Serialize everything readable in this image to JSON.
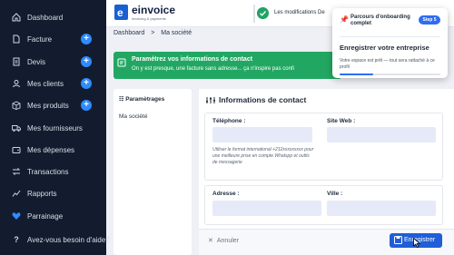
{
  "sidebar": {
    "items": [
      {
        "label": "Dashboard",
        "icon": "home-icon",
        "has_add": false
      },
      {
        "label": "Facture",
        "icon": "file-icon",
        "has_add": true
      },
      {
        "label": "Devis",
        "icon": "document-icon",
        "has_add": true
      },
      {
        "label": "Mes clients",
        "icon": "user-icon",
        "has_add": true
      },
      {
        "label": "Mes produits",
        "icon": "box-icon",
        "has_add": true
      },
      {
        "label": "Mes fournisseurs",
        "icon": "truck-icon",
        "has_add": false
      },
      {
        "label": "Mes dépenses",
        "icon": "wallet-icon",
        "has_add": false
      },
      {
        "label": "Transactions",
        "icon": "exchange-icon",
        "has_add": false
      },
      {
        "label": "Rapports",
        "icon": "chart-icon",
        "has_add": false
      },
      {
        "label": "Parrainage",
        "icon": "heart-icon",
        "has_add": false
      },
      {
        "label": "Avez-vous besoin d'aide?",
        "icon": "help-icon",
        "has_add": false
      }
    ],
    "add_symbol": "+"
  },
  "header": {
    "logo_letter": "e",
    "brand": "einvoice",
    "tagline": "invoicing & payments",
    "toast": "Les modifications De"
  },
  "breadcrumb": {
    "root": "Dashboard",
    "separator": ">",
    "current": "Ma société"
  },
  "banner": {
    "title": "Paramétrez vos informations de contact",
    "subtitle": "On y est presque, une facture sans adresse... ça n'inspire pas confi"
  },
  "settings": {
    "title": "Paramètrages",
    "item": "Ma société"
  },
  "contact": {
    "title": "Informations de contact",
    "phone_label": "Téléphone :",
    "phone_help": "Utiliser le format international +212xxxxxxxxx pour une meilleure prise en compte Whatspp et outils de messagerie",
    "website_label": "Site Web :",
    "address_label": "Adresse :",
    "city_label": "Ville :"
  },
  "footer": {
    "cancel": "Annuler",
    "save": "Enregistrer"
  },
  "onboarding": {
    "heading": "Parcours d'onboarding complet",
    "step": "Step 5",
    "title": "Enregistrer votre entreprise",
    "description": "Votre espace est prêt — tout sera rattaché à ce profil",
    "progress": 0.33
  },
  "colors": {
    "sidebar_bg": "#131c2e",
    "accent": "#2e8cff",
    "banner_green": "#22a762",
    "primary_button": "#1f5ed8"
  }
}
